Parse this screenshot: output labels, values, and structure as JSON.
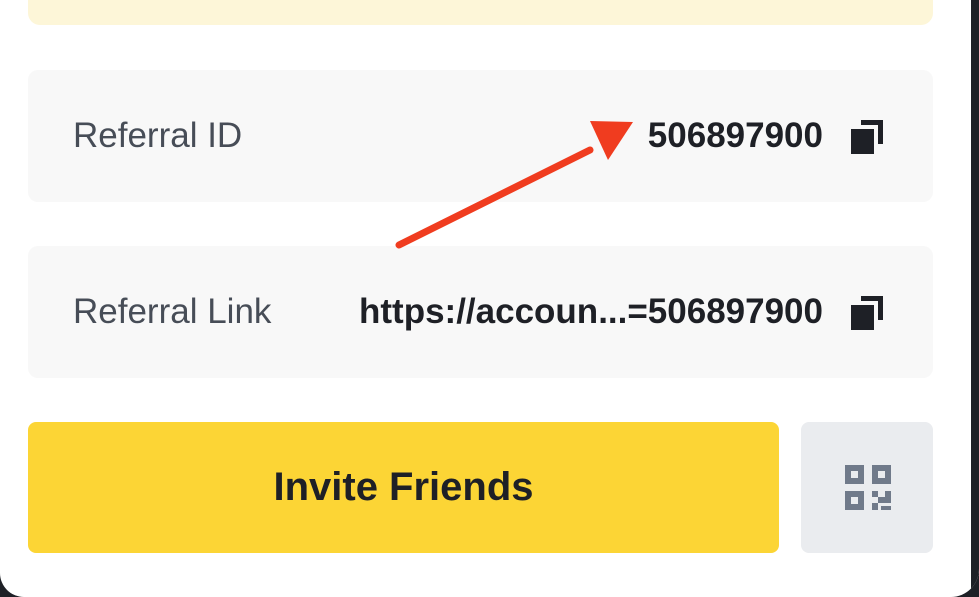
{
  "referral_id": {
    "label": "Referral ID",
    "value": "506897900",
    "copy_icon": "copy-icon"
  },
  "referral_link": {
    "label": "Referral Link",
    "value": "https://accoun...=506897900",
    "copy_icon": "copy-icon"
  },
  "actions": {
    "invite_label": "Invite Friends",
    "qr_icon": "qr-code-icon"
  },
  "colors": {
    "accent": "#fcd535",
    "notice_bg": "#fdf6d8",
    "card_bg": "#f8f8f8",
    "qr_button_bg": "#eaecef",
    "annotation_arrow": "#f03c1f",
    "text_primary": "#1e2026",
    "text_secondary": "#474d57"
  }
}
